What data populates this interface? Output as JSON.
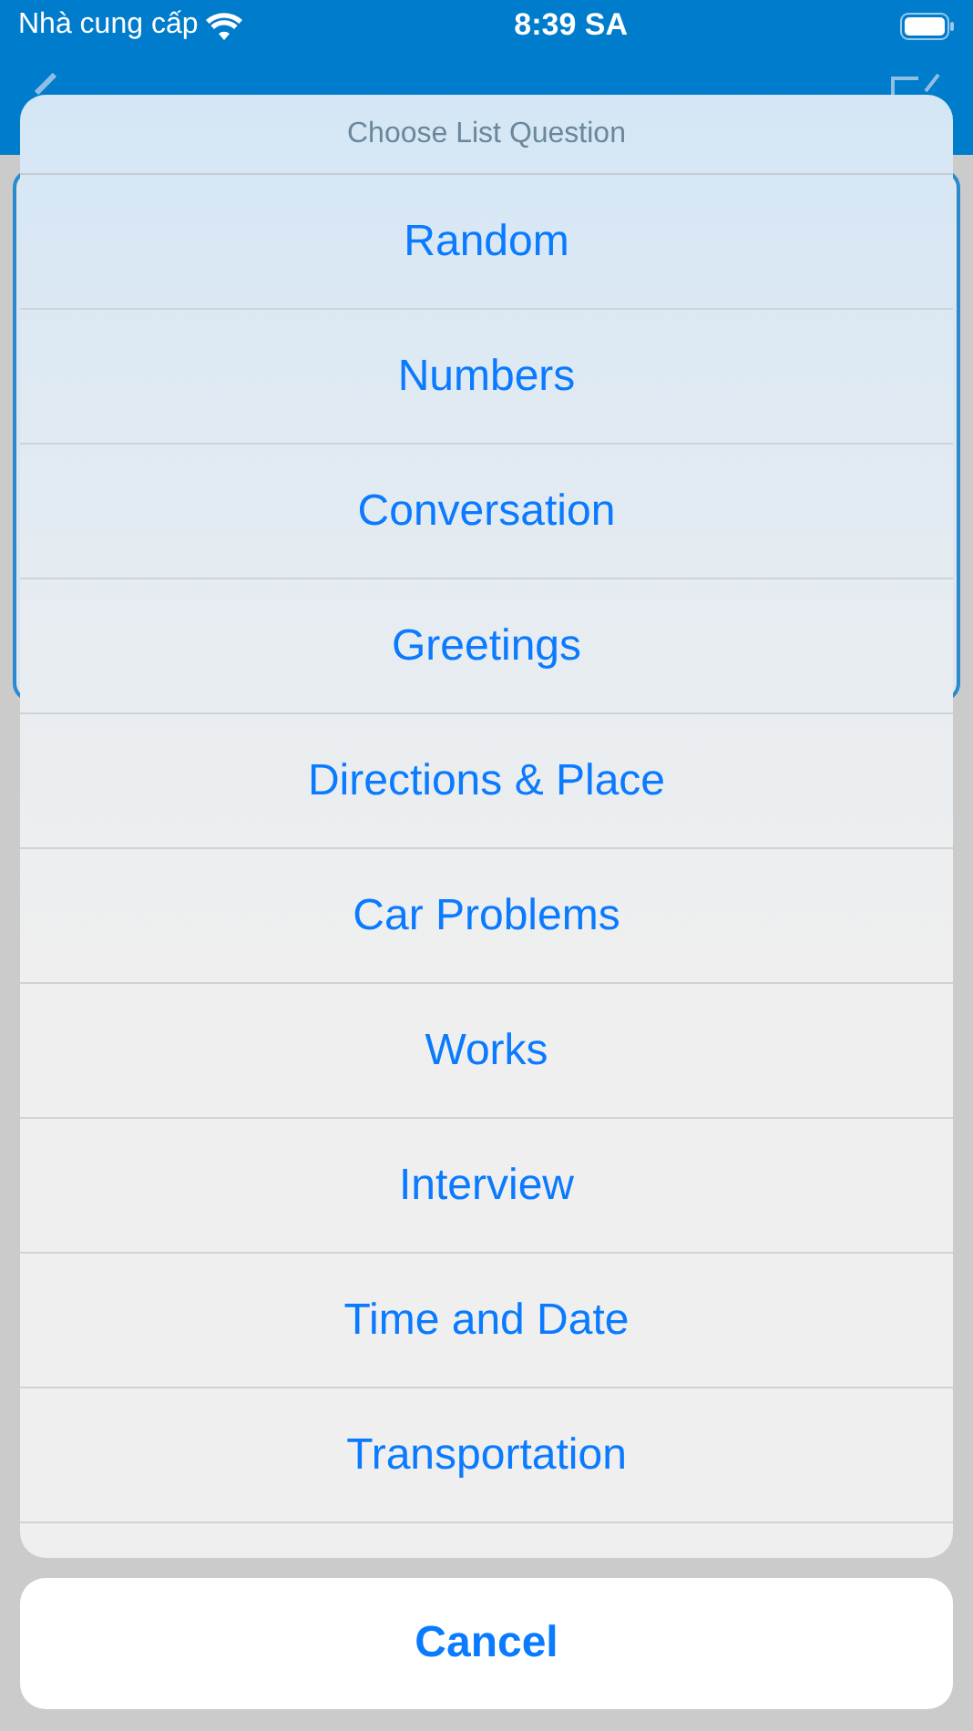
{
  "status_bar": {
    "carrier": "Nhà cung cấp",
    "time": "8:39 SA"
  },
  "action_sheet": {
    "title": "Choose List Question",
    "options": [
      "Random",
      "Numbers",
      "Conversation",
      "Greetings",
      "Directions & Place",
      "Car Problems",
      "Works",
      "Interview",
      "Time and Date",
      "Transportation"
    ],
    "cancel": "Cancel"
  }
}
